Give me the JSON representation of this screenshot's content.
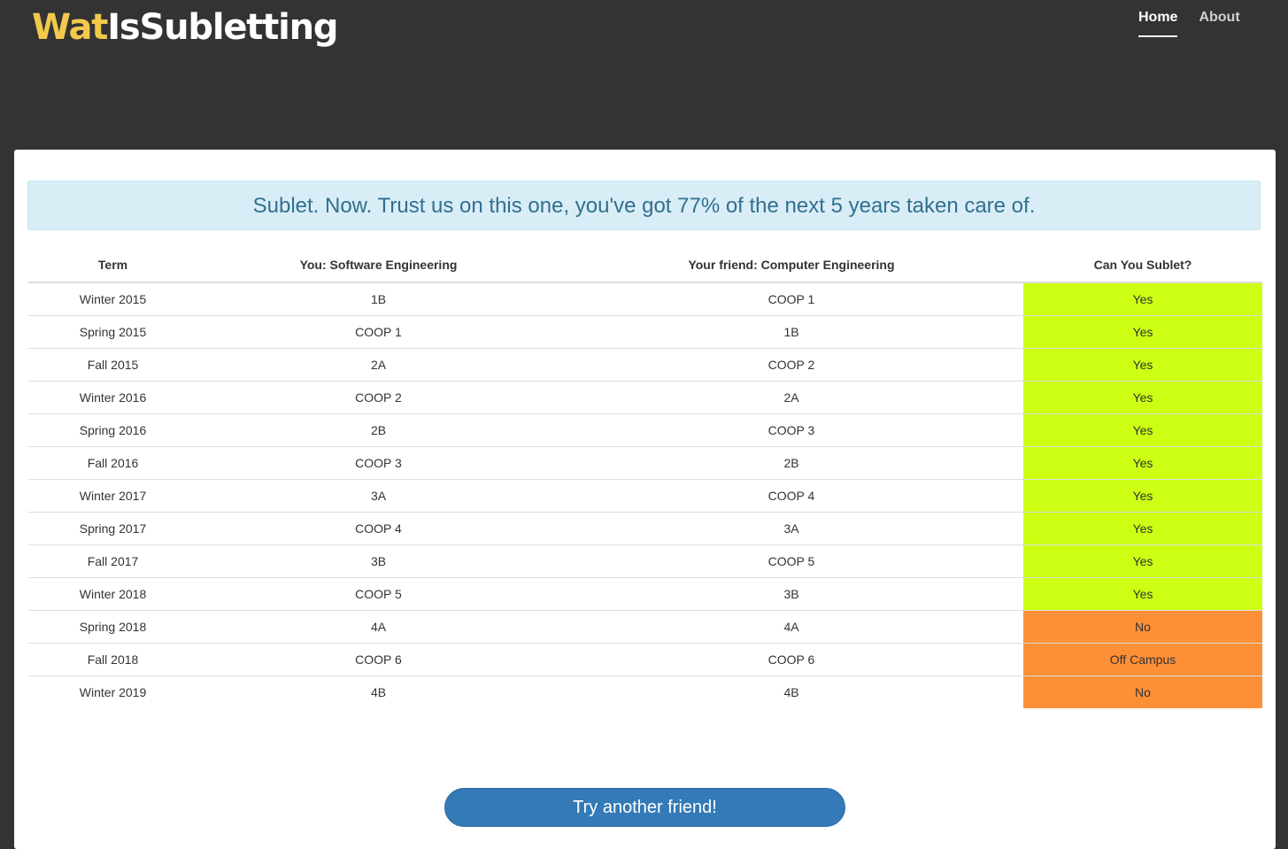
{
  "brand": {
    "part1": "Wat",
    "part2": "IsSubletting"
  },
  "nav": {
    "items": [
      {
        "label": "Home",
        "active": true
      },
      {
        "label": "About",
        "active": false
      }
    ]
  },
  "alert": {
    "message": "Sublet. Now. Trust us on this one, you've got 77% of the next 5 years taken care of."
  },
  "table": {
    "headers": [
      "Term",
      "You: Software Engineering",
      "Your friend: Computer Engineering",
      "Can You Sublet?"
    ],
    "rows": [
      {
        "term": "Winter 2015",
        "you": "1B",
        "friend": "COOP 1",
        "sublet": "Yes",
        "status": "yes"
      },
      {
        "term": "Spring 2015",
        "you": "COOP 1",
        "friend": "1B",
        "sublet": "Yes",
        "status": "yes"
      },
      {
        "term": "Fall 2015",
        "you": "2A",
        "friend": "COOP 2",
        "sublet": "Yes",
        "status": "yes"
      },
      {
        "term": "Winter 2016",
        "you": "COOP 2",
        "friend": "2A",
        "sublet": "Yes",
        "status": "yes"
      },
      {
        "term": "Spring 2016",
        "you": "2B",
        "friend": "COOP 3",
        "sublet": "Yes",
        "status": "yes"
      },
      {
        "term": "Fall 2016",
        "you": "COOP 3",
        "friend": "2B",
        "sublet": "Yes",
        "status": "yes"
      },
      {
        "term": "Winter 2017",
        "you": "3A",
        "friend": "COOP 4",
        "sublet": "Yes",
        "status": "yes"
      },
      {
        "term": "Spring 2017",
        "you": "COOP 4",
        "friend": "3A",
        "sublet": "Yes",
        "status": "yes"
      },
      {
        "term": "Fall 2017",
        "you": "3B",
        "friend": "COOP 5",
        "sublet": "Yes",
        "status": "yes"
      },
      {
        "term": "Winter 2018",
        "you": "COOP 5",
        "friend": "3B",
        "sublet": "Yes",
        "status": "yes"
      },
      {
        "term": "Spring 2018",
        "you": "4A",
        "friend": "4A",
        "sublet": "No",
        "status": "no"
      },
      {
        "term": "Fall 2018",
        "you": "COOP 6",
        "friend": "COOP 6",
        "sublet": "Off Campus",
        "status": "no"
      },
      {
        "term": "Winter 2019",
        "you": "4B",
        "friend": "4B",
        "sublet": "No",
        "status": "no"
      }
    ]
  },
  "actions": {
    "try_another_label": "Try another friend!"
  },
  "colors": {
    "header_bg": "#333333",
    "brand_accent": "#f2c94c",
    "yes": "#ccff13",
    "no": "#fd8f37",
    "alert_bg": "#d9edf7",
    "alert_text": "#31708f",
    "button": "#337ab7"
  }
}
